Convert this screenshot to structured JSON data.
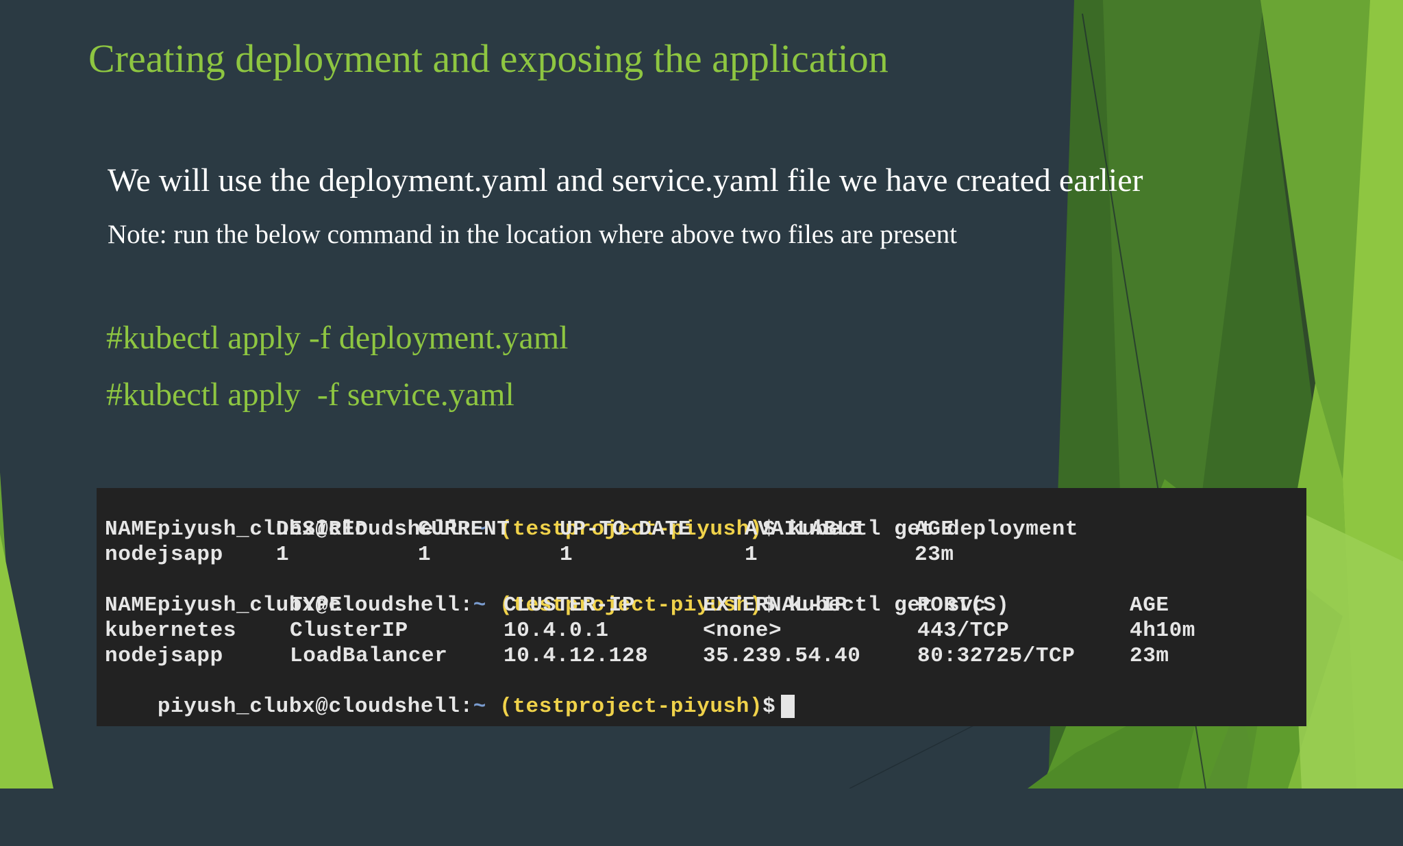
{
  "slide": {
    "title": "Creating deployment and exposing the application",
    "intro": "We will use the deployment.yaml and  service.yaml file we have created earlier",
    "note": "Note: run the below command in the location where above two files are present",
    "commands": [
      "#kubectl apply -f deployment.yaml",
      "#kubectl apply  -f service.yaml"
    ]
  },
  "terminal": {
    "prompt_user": "piyush_clubx@cloudshell:",
    "prompt_tilde": "~",
    "prompt_project": "(testproject-piyush)",
    "prompt_dollar": "$",
    "cmd_get_deployment": "kubectl get deployment",
    "cmd_get_svc": "kubectl get svc",
    "deployment_headers": [
      "NAME",
      "DESIRED",
      "CURRENT",
      "UP-TO-DATE",
      "AVAILABLE",
      "AGE"
    ],
    "deployment_rows": [
      [
        "nodejsapp",
        "1",
        "1",
        "1",
        "1",
        "23m"
      ]
    ],
    "svc_headers": [
      "NAME",
      "TYPE",
      "CLUSTER-IP",
      "EXTERNAL-IP",
      "PORT(S)",
      "AGE"
    ],
    "svc_rows": [
      [
        "kubernetes",
        "ClusterIP",
        "10.4.0.1",
        "<none>",
        "443/TCP",
        "4h10m"
      ],
      [
        "nodejsapp",
        "LoadBalancer",
        "10.4.12.128",
        "35.239.54.40",
        "80:32725/TCP",
        "23m"
      ]
    ]
  },
  "colors": {
    "background": "#2b3a43",
    "accent_green": "#8ec641",
    "terminal_bg": "#222222",
    "prompt_project": "#f0d24a"
  }
}
